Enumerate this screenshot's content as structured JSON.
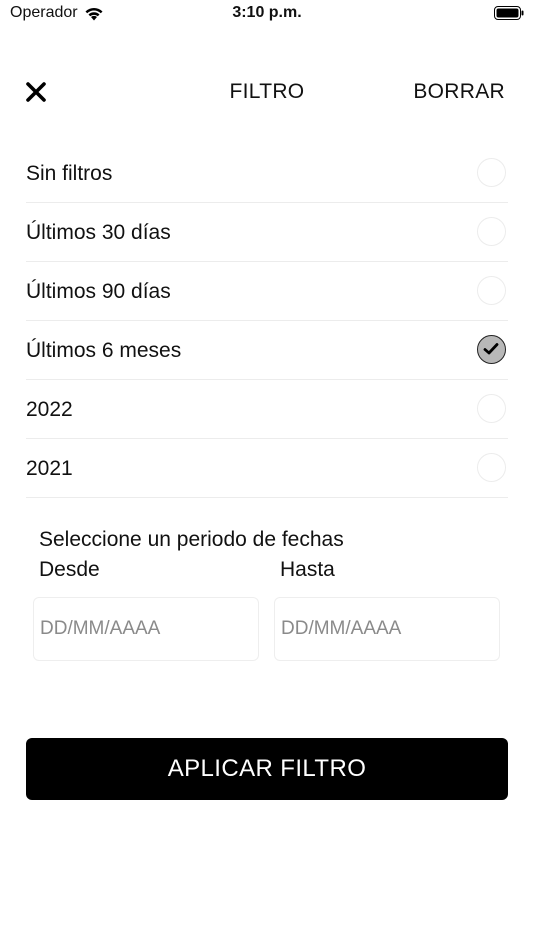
{
  "status_bar": {
    "carrier": "Operador",
    "time": "3:10 p.m.",
    "wifi_icon": "wifi-icon",
    "battery_icon": "battery-icon"
  },
  "header": {
    "close_icon": "close-icon",
    "title": "FILTRO",
    "clear_label": "BORRAR"
  },
  "options": [
    {
      "label": "Sin filtros",
      "selected": false
    },
    {
      "label": "Últimos 30 días",
      "selected": false
    },
    {
      "label": "Últimos 90 días",
      "selected": false
    },
    {
      "label": "Últimos 6 meses",
      "selected": true
    },
    {
      "label": "2022",
      "selected": false
    },
    {
      "label": "2021",
      "selected": false
    }
  ],
  "date_range": {
    "title": "Seleccione un periodo de fechas",
    "from_label": "Desde",
    "to_label": "Hasta",
    "from_placeholder": "DD/MM/AAAA",
    "to_placeholder": "DD/MM/AAAA"
  },
  "apply_label": "APLICAR FILTRO",
  "colors": {
    "button_background": "#000000",
    "selected_radio": "#b8b8b8",
    "divider": "#ececec"
  }
}
